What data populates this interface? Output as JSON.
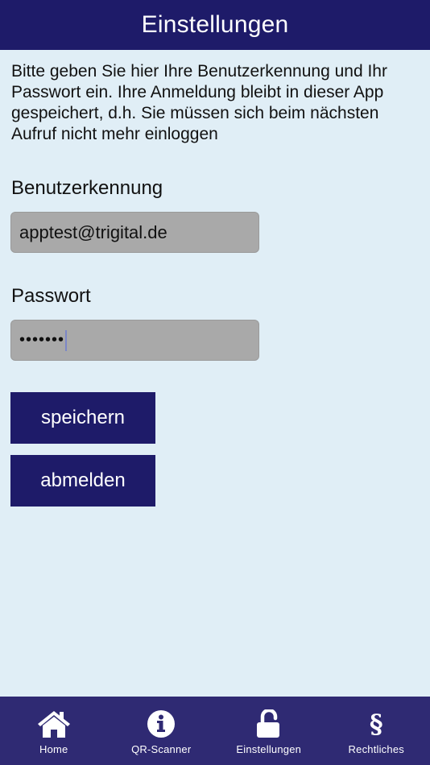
{
  "header": {
    "title": "Einstellungen"
  },
  "intro": {
    "text": "Bitte geben Sie hier Ihre Benutzerkennung und Ihr Passwort ein. Ihre Anmeldung bleibt in dieser App gespeichert, d.h. Sie müssen sich beim nächsten Aufruf nicht mehr einloggen"
  },
  "form": {
    "username_label": "Benutzerkennung",
    "username_value": "apptest@trigital.de",
    "password_label": "Passwort",
    "password_masked": "•••••••"
  },
  "buttons": {
    "save_label": "speichern",
    "logout_label": "abmelden"
  },
  "tabbar": {
    "items": [
      {
        "label": "Home",
        "icon": "home-icon"
      },
      {
        "label": "QR-Scanner",
        "icon": "info-icon"
      },
      {
        "label": "Einstellungen",
        "icon": "unlock-icon"
      },
      {
        "label": "Rechtliches",
        "icon": "paragraph-icon"
      }
    ]
  },
  "colors": {
    "primary": "#1e1b69",
    "tabbar": "#2f2a73",
    "background": "#e0eef6",
    "input_bg": "#a9a9a9"
  }
}
